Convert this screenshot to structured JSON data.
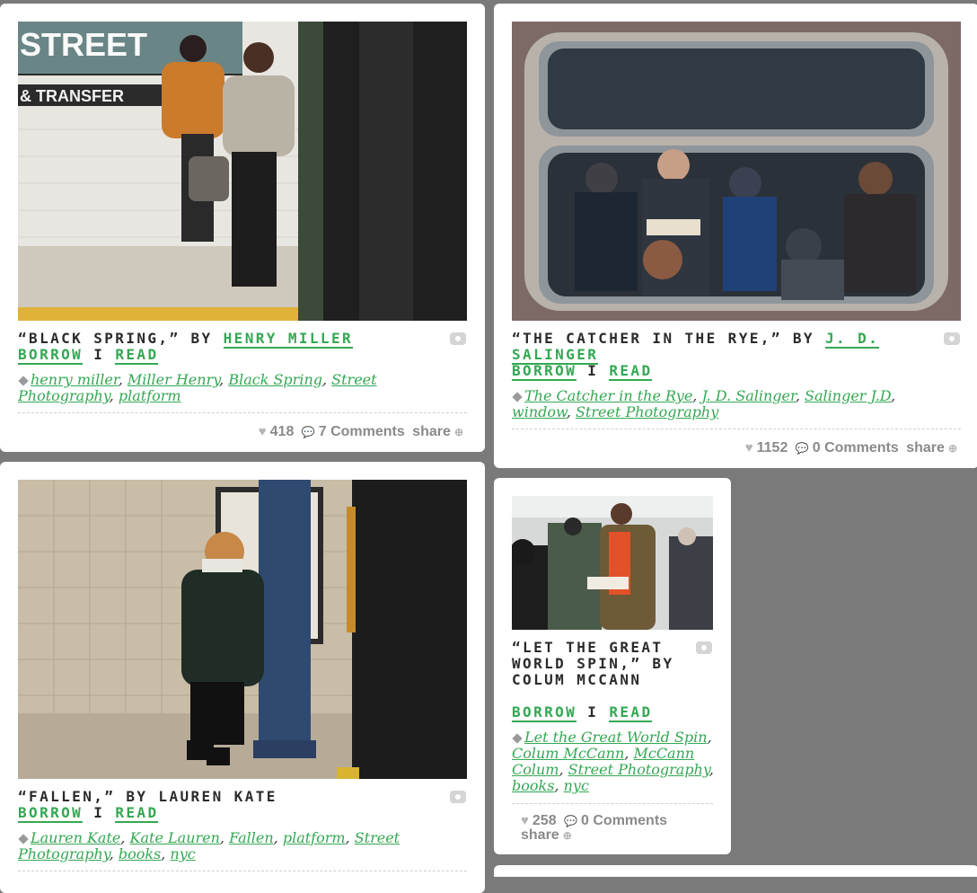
{
  "common": {
    "borrow": "BORROW",
    "read": "READ",
    "sep": "I",
    "share": "share",
    "comments_word": "Comments"
  },
  "posts": [
    {
      "title_prefix": "“BLACK SPRING,” BY",
      "author": "HENRY MILLER",
      "tags": [
        "henry miller",
        "Miller Henry",
        "Black Spring",
        "Street Photography",
        "platform"
      ],
      "likes": "418",
      "comments": "7 Comments"
    },
    {
      "title_prefix": "“THE CATCHER IN THE RYE,” BY",
      "author": "J. D. SALINGER",
      "tags": [
        "The Catcher in the Rye",
        "J. D. Salinger",
        "Salinger J.D",
        "window",
        "Street Photography"
      ],
      "likes": "1152",
      "comments": "0 Comments"
    },
    {
      "title_full": "“FALLEN,” BY LAUREN KATE",
      "tags": [
        "Lauren Kate",
        "Kate Lauren",
        "Fallen",
        "platform",
        "Street Photography",
        "books",
        "nyc"
      ]
    },
    {
      "title_full": "“LET THE GREAT WORLD SPIN,” BY COLUM MCCANN",
      "tags": [
        "Let the Great World Spin",
        "Colum McCann",
        "McCann Colum",
        "Street Photography",
        "books",
        "nyc"
      ],
      "likes": "258",
      "comments": "0 Comments"
    }
  ],
  "photo_text": {
    "street": "STREET",
    "transfer": "& TRANSFER"
  },
  "icons": {
    "heart": "heart-icon",
    "comment": "comment-icon",
    "share": "share-icon",
    "camera": "camera-icon",
    "tag": "tag-icon"
  },
  "colors": {
    "background": "#7a7a7a",
    "card": "#ffffff",
    "link": "#34a853"
  }
}
